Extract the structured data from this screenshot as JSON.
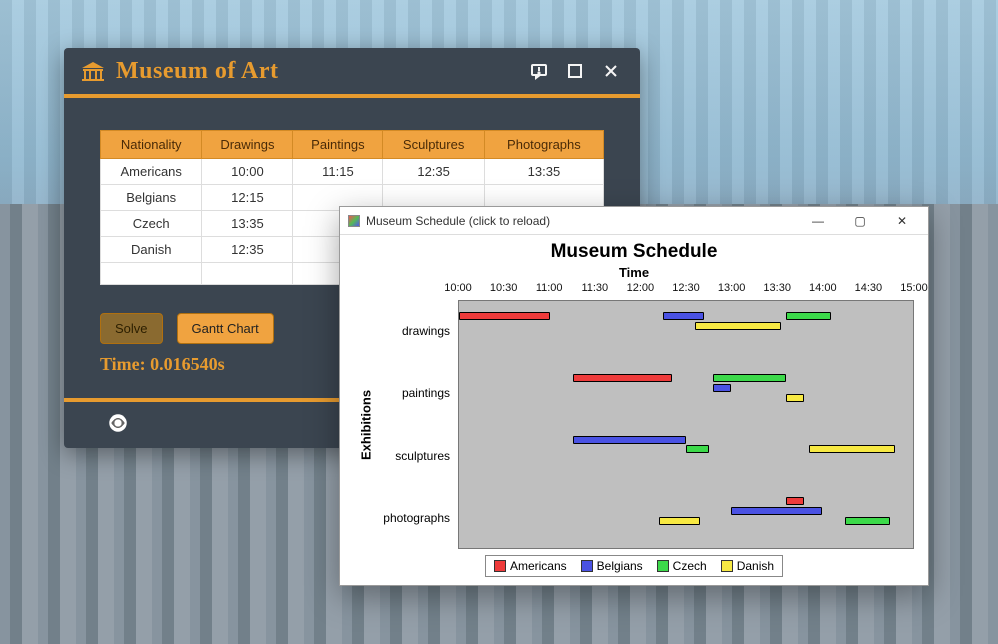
{
  "app": {
    "title": "Museum of Art"
  },
  "table": {
    "headers": [
      "Nationality",
      "Drawings",
      "Paintings",
      "Sculptures",
      "Photographs"
    ],
    "rows": [
      [
        "Americans",
        "10:00",
        "11:15",
        "12:35",
        "13:35"
      ],
      [
        "Belgians",
        "12:15",
        "",
        "",
        ""
      ],
      [
        "Czech",
        "13:35",
        "",
        "",
        ""
      ],
      [
        "Danish",
        "12:35",
        "",
        "",
        ""
      ]
    ]
  },
  "buttons": {
    "solve": "Solve",
    "gantt": "Gantt Chart"
  },
  "time_label": "Time: 0.016540s",
  "chart_window": {
    "title": "Museum Schedule (click to reload)"
  },
  "chart_data": {
    "type": "gantt",
    "title": "Museum Schedule",
    "xtitle_top": "Time",
    "ylabel": "Exhibitions",
    "x_ticks": [
      "10:00",
      "10:30",
      "11:00",
      "11:30",
      "12:00",
      "12:30",
      "13:00",
      "13:30",
      "14:00",
      "14:30",
      "15:00"
    ],
    "x_range": [
      10.0,
      15.0
    ],
    "categories": [
      "drawings",
      "paintings",
      "sculptures",
      "photographs"
    ],
    "series": [
      {
        "name": "Americans",
        "color": "#ee3b3b"
      },
      {
        "name": "Belgians",
        "color": "#4a52e3"
      },
      {
        "name": "Czech",
        "color": "#3cd94a"
      },
      {
        "name": "Danish",
        "color": "#f7e943"
      }
    ],
    "bars": [
      {
        "cat": "drawings",
        "series": "Americans",
        "level": 0,
        "start": 10.0,
        "end": 11.0
      },
      {
        "cat": "drawings",
        "series": "Belgians",
        "level": 0,
        "start": 12.25,
        "end": 12.7
      },
      {
        "cat": "drawings",
        "series": "Danish",
        "level": 1,
        "start": 12.6,
        "end": 13.55
      },
      {
        "cat": "drawings",
        "series": "Czech",
        "level": 0,
        "start": 13.6,
        "end": 14.1
      },
      {
        "cat": "paintings",
        "series": "Americans",
        "level": 0,
        "start": 11.25,
        "end": 12.35
      },
      {
        "cat": "paintings",
        "series": "Czech",
        "level": 0,
        "start": 12.8,
        "end": 13.6
      },
      {
        "cat": "paintings",
        "series": "Belgians",
        "level": 1,
        "start": 12.8,
        "end": 13.0
      },
      {
        "cat": "paintings",
        "series": "Danish",
        "level": 2,
        "start": 13.6,
        "end": 13.8
      },
      {
        "cat": "sculptures",
        "series": "Belgians",
        "level": 0,
        "start": 11.25,
        "end": 12.5
      },
      {
        "cat": "sculptures",
        "series": "Czech",
        "level": 1,
        "start": 12.5,
        "end": 12.75
      },
      {
        "cat": "sculptures",
        "series": "Danish",
        "level": 1,
        "start": 13.85,
        "end": 14.8
      },
      {
        "cat": "photographs",
        "series": "Americans",
        "level": 0,
        "start": 13.6,
        "end": 13.8
      },
      {
        "cat": "photographs",
        "series": "Belgians",
        "level": 1,
        "start": 13.0,
        "end": 14.0
      },
      {
        "cat": "photographs",
        "series": "Danish",
        "level": 2,
        "start": 12.2,
        "end": 12.65
      },
      {
        "cat": "photographs",
        "series": "Czech",
        "level": 2,
        "start": 14.25,
        "end": 14.75
      }
    ]
  }
}
